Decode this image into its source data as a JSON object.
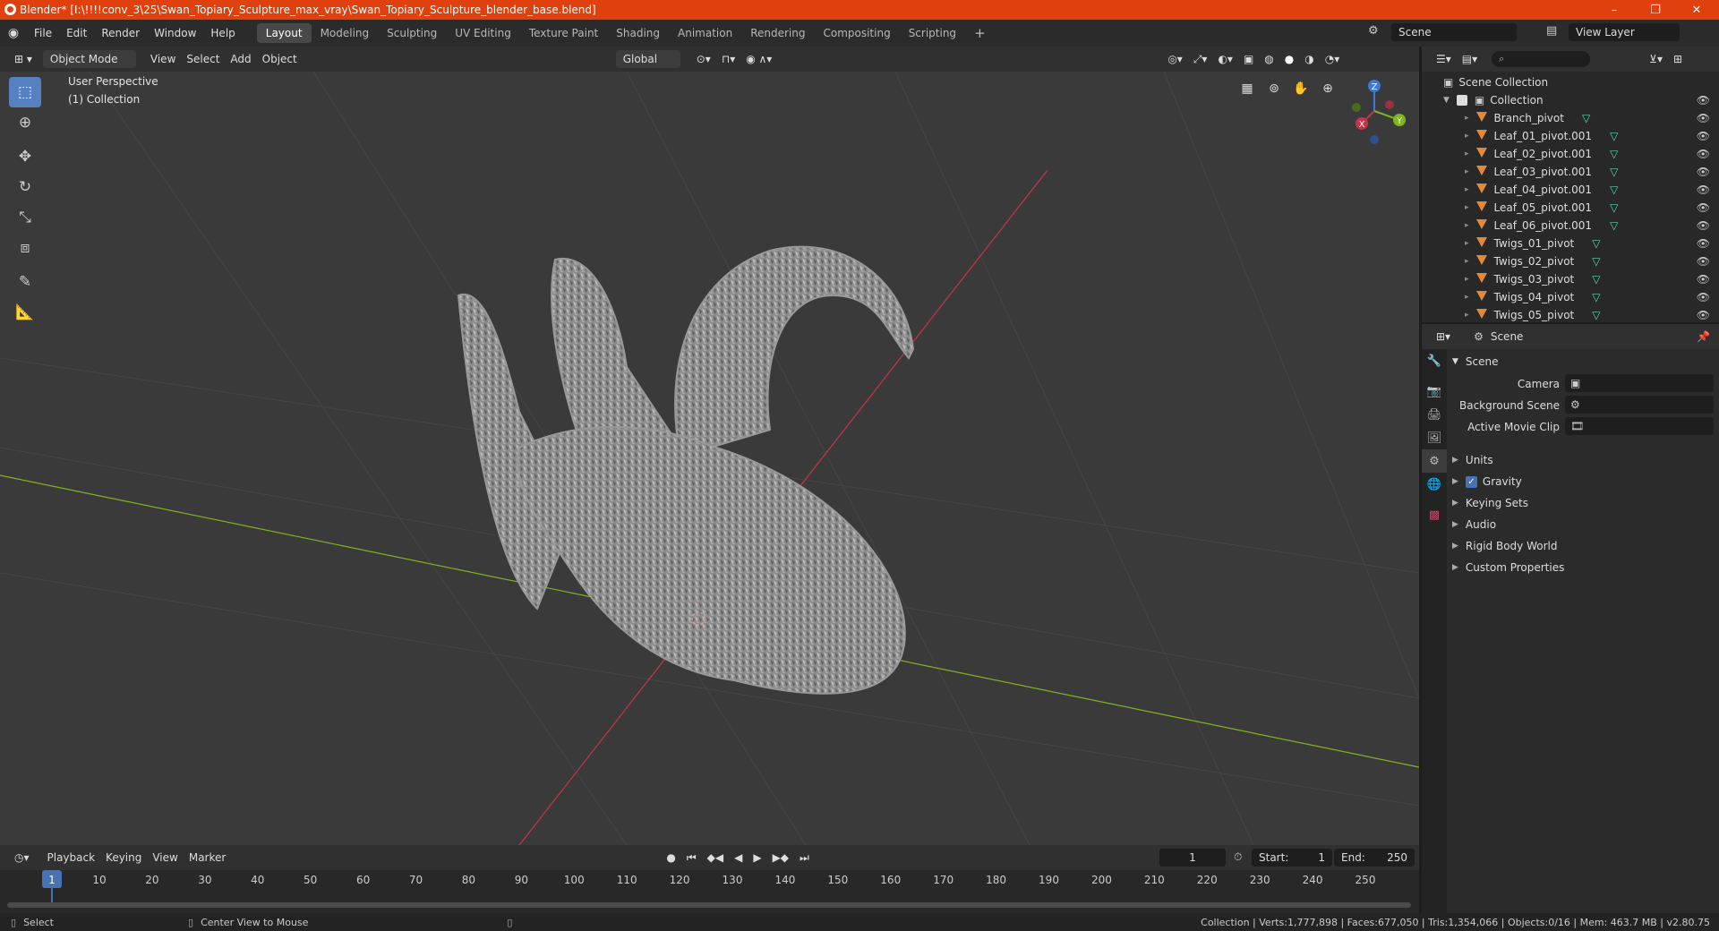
{
  "window": {
    "title": "Blender* [I:\\!!!!conv_3\\25\\Swan_Topiary_Sculpture_max_vray\\Swan_Topiary_Sculpture_blender_base.blend]",
    "minimize": "–",
    "maximize": "❐",
    "close": "✕"
  },
  "menu": [
    "File",
    "Edit",
    "Render",
    "Window",
    "Help"
  ],
  "workspaces": [
    "Layout",
    "Modeling",
    "Sculpting",
    "UV Editing",
    "Texture Paint",
    "Shading",
    "Animation",
    "Rendering",
    "Compositing",
    "Scripting"
  ],
  "active_workspace": "Layout",
  "scene_name": "Scene",
  "view_layer": "View Layer",
  "viewport_header": {
    "mode": "Object Mode",
    "menus": [
      "View",
      "Select",
      "Add",
      "Object"
    ],
    "orientation": "Global"
  },
  "viewport": {
    "perspective": "User Perspective",
    "collection": "(1) Collection",
    "gizmo_axes": {
      "x": "X",
      "y": "Y",
      "z": "Z"
    }
  },
  "outliner": {
    "root": "Scene Collection",
    "collection": "Collection",
    "objects": [
      "Branch_pivot",
      "Leaf_01_pivot.001",
      "Leaf_02_pivot.001",
      "Leaf_03_pivot.001",
      "Leaf_04_pivot.001",
      "Leaf_05_pivot.001",
      "Leaf_06_pivot.001",
      "Twigs_01_pivot",
      "Twigs_02_pivot",
      "Twigs_03_pivot",
      "Twigs_04_pivot",
      "Twigs_05_pivot"
    ]
  },
  "properties": {
    "header": "Scene",
    "panel_title": "Scene",
    "camera_label": "Camera",
    "background_scene_label": "Background Scene",
    "active_movie_clip_label": "Active Movie Clip",
    "subpanels": [
      "Units",
      "Gravity",
      "Keying Sets",
      "Audio",
      "Rigid Body World",
      "Custom Properties"
    ],
    "gravity_checked": true
  },
  "timeline": {
    "menus": [
      "Playback",
      "Keying",
      "View",
      "Marker"
    ],
    "current_frame": "1",
    "start_label": "Start:",
    "start": "1",
    "end_label": "End:",
    "end": "250",
    "ticks": [
      "1",
      "10",
      "20",
      "30",
      "40",
      "50",
      "60",
      "70",
      "80",
      "90",
      "100",
      "110",
      "120",
      "130",
      "140",
      "150",
      "160",
      "170",
      "180",
      "190",
      "200",
      "210",
      "220",
      "230",
      "240",
      "250"
    ]
  },
  "status": {
    "select": "Select",
    "center_view": "Center View to Mouse",
    "stats": "Collection | Verts:1,777,898 | Faces:677,050 | Tris:1,354,066 | Objects:0/16 | Mem: 463.7 MB | v2.80.75"
  },
  "colors": {
    "titlebar": "#e0400d",
    "accent_blue": "#5680c2",
    "x_axis": "#c8334a",
    "y_axis": "#7fb51f",
    "z_axis": "#3d7ad6",
    "object_icon": "#e08a3a",
    "mesh_icon": "#5fd1b5"
  }
}
